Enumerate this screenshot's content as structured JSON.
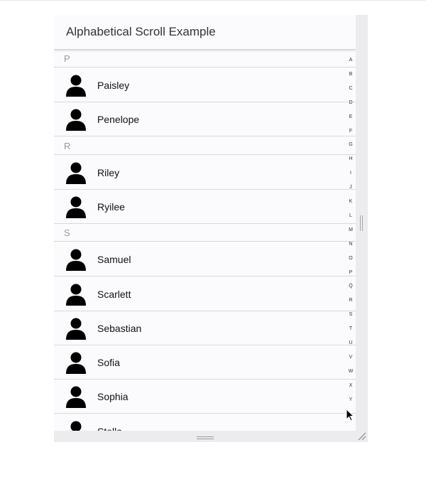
{
  "window": {
    "title": "Alphabetical Scroll Example"
  },
  "groups": [
    {
      "letter": "P",
      "items": [
        "Paisley",
        "Penelope"
      ]
    },
    {
      "letter": "R",
      "items": [
        "Riley",
        "Ryilee"
      ]
    },
    {
      "letter": "S",
      "items": [
        "Samuel",
        "Scarlett",
        "Sebastian",
        "Sofia",
        "Sophia",
        "Stella"
      ]
    }
  ],
  "index_letters": [
    "A",
    "B",
    "C",
    "D",
    "E",
    "F",
    "G",
    "H",
    "I",
    "J",
    "K",
    "L",
    "M",
    "N",
    "O",
    "P",
    "Q",
    "R",
    "S",
    "T",
    "U",
    "V",
    "W",
    "X",
    "Y"
  ],
  "icons": {
    "item_avatar": "person-icon"
  },
  "colors": {
    "background": "#fbfbfd",
    "divider_text": "#999999",
    "item_text": "#111111"
  }
}
